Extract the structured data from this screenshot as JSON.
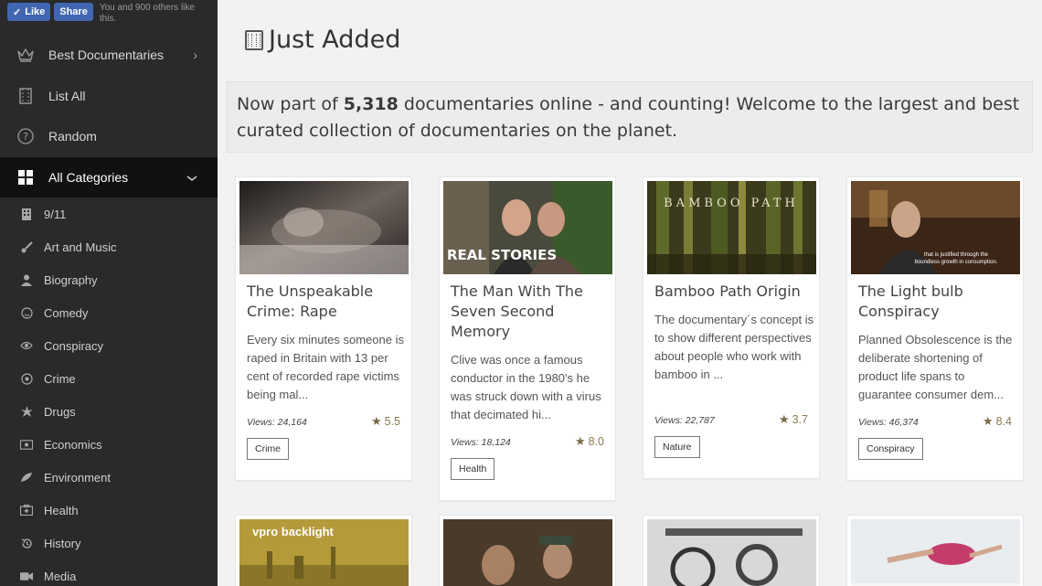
{
  "facebook": {
    "like_label": "Like",
    "share_label": "Share",
    "note": "You and 900 others like this."
  },
  "nav": [
    {
      "label": "Best Documentaries",
      "icon": "crown-icon",
      "trailing": "›"
    },
    {
      "label": "List All",
      "icon": "film-icon"
    },
    {
      "label": "Random",
      "icon": "question-icon"
    },
    {
      "label": "All Categories",
      "icon": "grid-icon",
      "trailing": "⌄"
    }
  ],
  "categories": [
    {
      "label": "9/11",
      "icon": "building-icon"
    },
    {
      "label": "Art and Music",
      "icon": "brush-icon"
    },
    {
      "label": "Biography",
      "icon": "user-icon"
    },
    {
      "label": "Comedy",
      "icon": "smile-icon"
    },
    {
      "label": "Conspiracy",
      "icon": "eye-icon"
    },
    {
      "label": "Crime",
      "icon": "target-icon"
    },
    {
      "label": "Drugs",
      "icon": "leaf-icon"
    },
    {
      "label": "Economics",
      "icon": "money-icon"
    },
    {
      "label": "Environment",
      "icon": "feather-icon"
    },
    {
      "label": "Health",
      "icon": "medkit-icon"
    },
    {
      "label": "History",
      "icon": "history-icon"
    },
    {
      "label": "Media",
      "icon": "camera-icon"
    }
  ],
  "page": {
    "title": "Just Added",
    "welcome_prefix": "Now part of ",
    "welcome_count": "5,318",
    "welcome_suffix": " documentaries online - and counting! Welcome to the largest and best curated collection of documentaries on the planet."
  },
  "cards": [
    {
      "title": "The Unspeakable Crime: Rape",
      "description": "Every six minutes someone is raped in Britain with 13 per cent of recorded rape victims being mal...",
      "views": "Views: 24,164",
      "rating": "5.5",
      "tag": "Crime"
    },
    {
      "title": "The Man With The Seven Second Memory",
      "description": "Clive was once a famous conductor in the 1980's he was struck down with a virus that decimated hi...",
      "views": "Views: 18,124",
      "rating": "8.0",
      "tag": "Health",
      "thumb_text": "REAL STORIES"
    },
    {
      "title": "Bamboo Path Origin",
      "description": "The documentary´s concept is to show different perspectives about people who work with bamboo in ...",
      "views": "Views: 22,787",
      "rating": "3.7",
      "tag": "Nature",
      "thumb_text": "BAMBOO PATH"
    },
    {
      "title": "The Light bulb Conspiracy",
      "description": "Planned Obsolescence is the deliberate shortening of product life spans to guarantee consumer dem...",
      "views": "Views: 46,374",
      "rating": "8.4",
      "tag": "Conspiracy",
      "thumb_text": "that is justified through the boundless growth in consumption."
    }
  ],
  "row2_thumbs": [
    {
      "thumb_text": "vpro backlight"
    }
  ]
}
